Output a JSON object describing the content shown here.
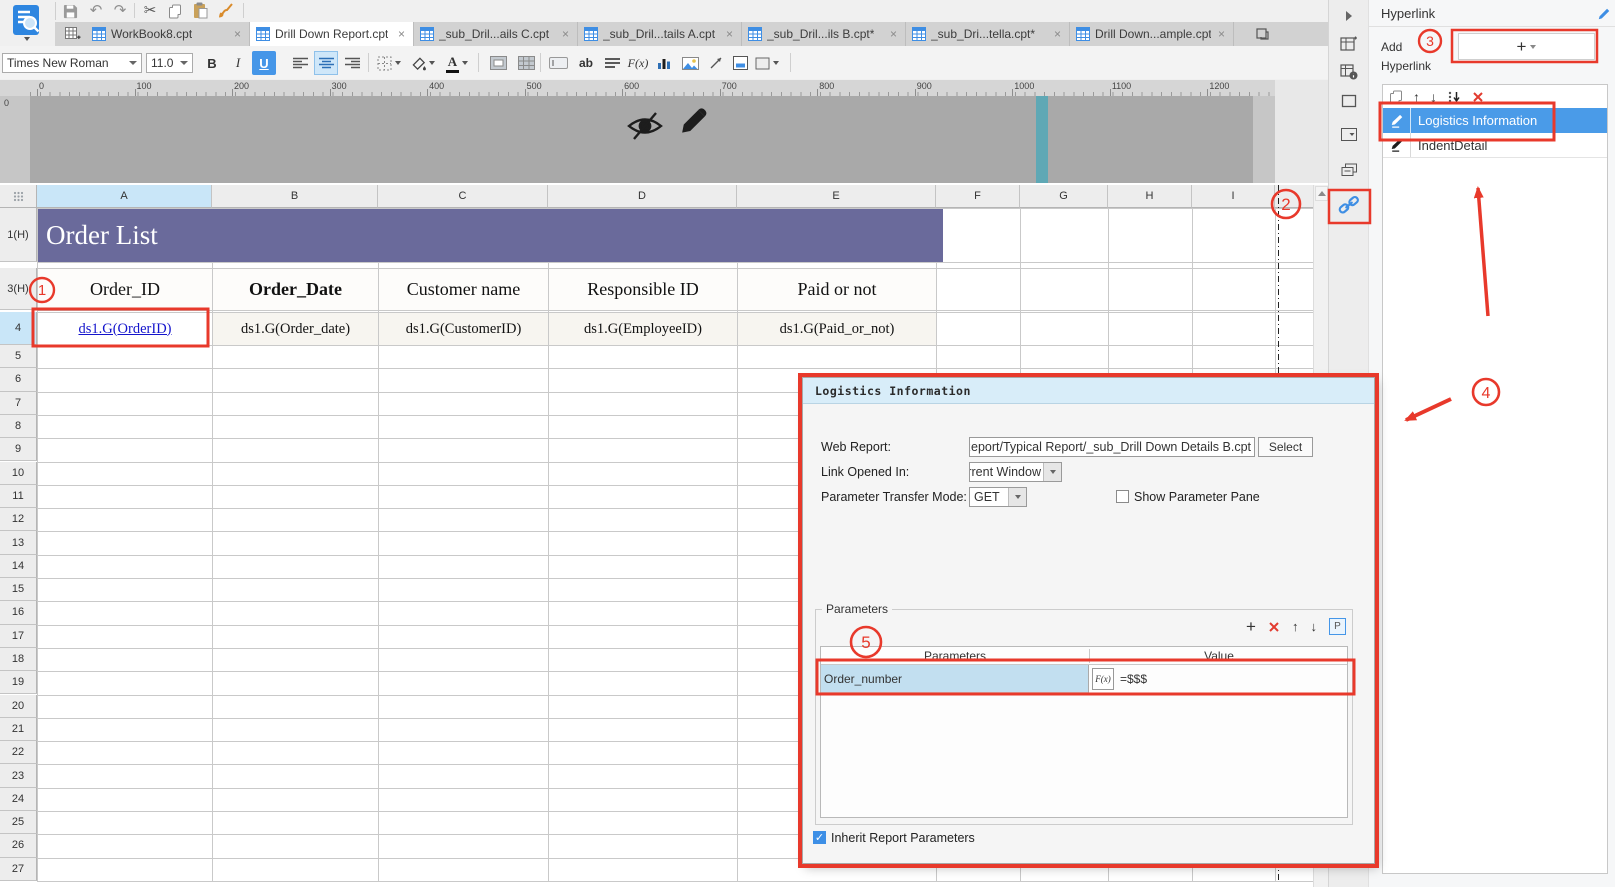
{
  "colors": {
    "accent_blue": "#3E8EE4",
    "selection_blue": "#4A9BE8",
    "annotation_red": "#E8392B",
    "banner_purple": "#6A6A9B",
    "dialog_titlebar_blue": "#D8EDF9",
    "hyperlink_text_blue": "#1414CC",
    "teal_marker": "#5FA8B5"
  },
  "quick_toolbar": {
    "icons": [
      "save",
      "undo",
      "redo",
      "cut",
      "copy",
      "paste",
      "format-painter"
    ]
  },
  "tab_bar": {
    "close_glyph": "×",
    "tabs": [
      {
        "label": "WorkBook8.cpt",
        "active": false
      },
      {
        "label": "Drill Down Report.cpt",
        "active": true
      },
      {
        "label": "_sub_Dril...ails C.cpt",
        "active": false
      },
      {
        "label": "_sub_Dril...tails A.cpt",
        "active": false
      },
      {
        "label": "_sub_Dril...ils B.cpt*",
        "active": false
      },
      {
        "label": "_sub_Dri...tella.cpt*",
        "active": false
      },
      {
        "label": "Drill Down...ample.cpt",
        "active": false
      }
    ]
  },
  "format_toolbar": {
    "font_name": "Times New Roman",
    "font_size": "11.0",
    "bold_label": "B",
    "italic_label": "I",
    "underline_label": "U",
    "ab_label": "ab",
    "fx_label": "F(x)"
  },
  "ruler": {
    "ticks": [
      "0",
      "100",
      "200",
      "300",
      "400",
      "500",
      "600",
      "700",
      "800",
      "900",
      "1000",
      "1100",
      "1200"
    ],
    "vertical_origin": "0"
  },
  "grid": {
    "columns": [
      "A",
      "B",
      "C",
      "D",
      "E",
      "F",
      "G",
      "H",
      "I"
    ],
    "rows": [
      "1(H)",
      "3(H)",
      "4",
      "5",
      "6",
      "7",
      "8",
      "9",
      "10",
      "11",
      "12",
      "13",
      "14",
      "15",
      "16",
      "17",
      "18",
      "19",
      "20",
      "21",
      "22",
      "23",
      "24",
      "25",
      "26",
      "27"
    ],
    "banner_title": "Order List",
    "header_row": [
      "Order_ID",
      "Order_Date",
      "Customer name",
      "Responsible ID",
      "Paid or not"
    ],
    "data_row": [
      "ds1.G(OrderID)",
      "ds1.G(Order_date)",
      "ds1.G(CustomerID)",
      "ds1.G(EmployeeID)",
      "ds1.G(Paid_or_not)"
    ]
  },
  "dialog": {
    "title": "Logistics Information",
    "web_report_label": "Web Report:",
    "web_report_value": "demo/Report/Typical Report/_sub_Drill Down Details B.cpt",
    "select_button_label": "Select",
    "link_opened_label": "Link Opened In:",
    "link_opened_value": "Current Window",
    "transfer_mode_label": "Parameter Transfer Mode:",
    "transfer_mode_value": "GET",
    "show_parameter_pane_label": "Show Parameter Pane",
    "parameters_group_label": "Parameters",
    "p_button_label": "P",
    "parameters_table": {
      "headers": [
        "Parameters",
        "Value"
      ],
      "rows": [
        {
          "parameter": "Order_number",
          "fx_button": "F(x)",
          "value": "=$$$"
        }
      ]
    },
    "inherit_label": "Inherit Report Parameters"
  },
  "hyperlink_panel": {
    "title": "Hyperlink",
    "add_label_line1": "Add",
    "add_label_line2": "Hyperlink",
    "add_button_label": "+",
    "items": [
      {
        "label": "Logistics Information",
        "selected": true
      },
      {
        "label": "IndentDetail",
        "selected": false
      }
    ]
  },
  "annotations": {
    "step1": "1",
    "step2": "2",
    "step3": "3",
    "step4": "4",
    "step5": "5"
  }
}
